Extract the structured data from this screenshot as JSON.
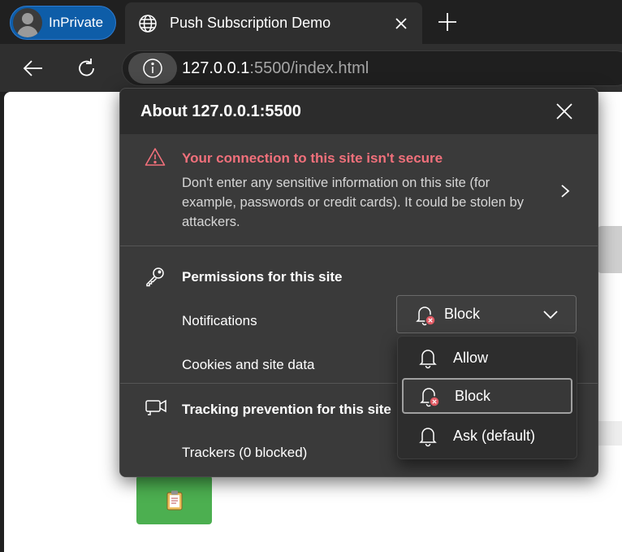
{
  "browser": {
    "inprivate_label": "InPrivate",
    "tab_title": "Push Subscription Demo",
    "url_host": "127.0.0.1",
    "url_rest": ":5500/index.html"
  },
  "site_info": {
    "title": "About 127.0.0.1:5500",
    "warning_title": "Your connection to this site isn't secure",
    "warning_text": "Don't enter any sensitive information on this site (for example, passwords or credit cards). It could be stolen by attackers.",
    "permissions_title": "Permissions for this site",
    "notifications_label": "Notifications",
    "notifications_value": "Block",
    "cookies_label": "Cookies and site data",
    "tracking_title": "Tracking prevention for this site",
    "trackers_label": "Trackers (0 blocked)"
  },
  "notification_options": [
    {
      "label": "Allow"
    },
    {
      "label": "Block"
    },
    {
      "label": "Ask (default)"
    }
  ],
  "colors": {
    "warning": "#f1707b",
    "inprivate": "#0e5da8",
    "page_button": "#4caf50"
  },
  "icons": [
    "globe-icon",
    "close-icon",
    "plus-icon",
    "back-arrow-icon",
    "refresh-icon",
    "info-icon",
    "warning-icon",
    "chevron-right-icon",
    "key-icon",
    "bell-blocked-icon",
    "chevron-down-icon",
    "camera-icon",
    "bell-icon",
    "clipboard-icon"
  ]
}
